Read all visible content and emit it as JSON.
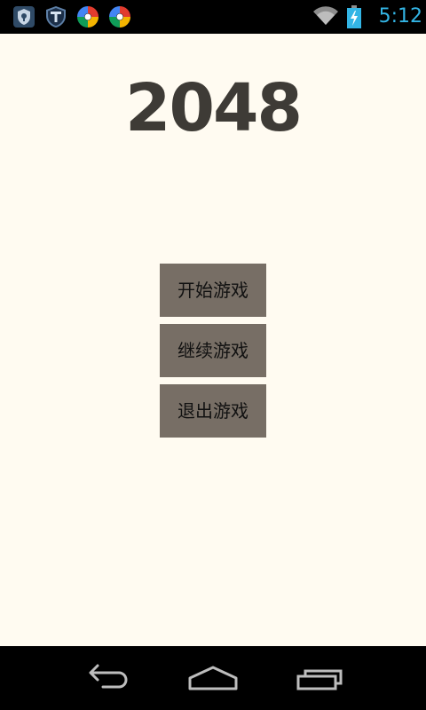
{
  "status_bar": {
    "time": "5:12",
    "notification_icons": [
      "shield-security-icon",
      "antivirus-shield-icon",
      "colorful-app-icon",
      "colorful-app-icon"
    ],
    "wifi_icon": "wifi-icon",
    "battery_icon": "battery-charging-icon",
    "clock_color": "#33b5e5"
  },
  "app": {
    "title": "2048",
    "background_color": "#fffbf1",
    "buttons": [
      {
        "label": "开始游戏"
      },
      {
        "label": "继续游戏"
      },
      {
        "label": "退出游戏"
      }
    ],
    "button_color": "#776e65"
  },
  "nav_bar": {
    "icons": [
      "back-icon",
      "home-icon",
      "recent-apps-icon"
    ]
  }
}
